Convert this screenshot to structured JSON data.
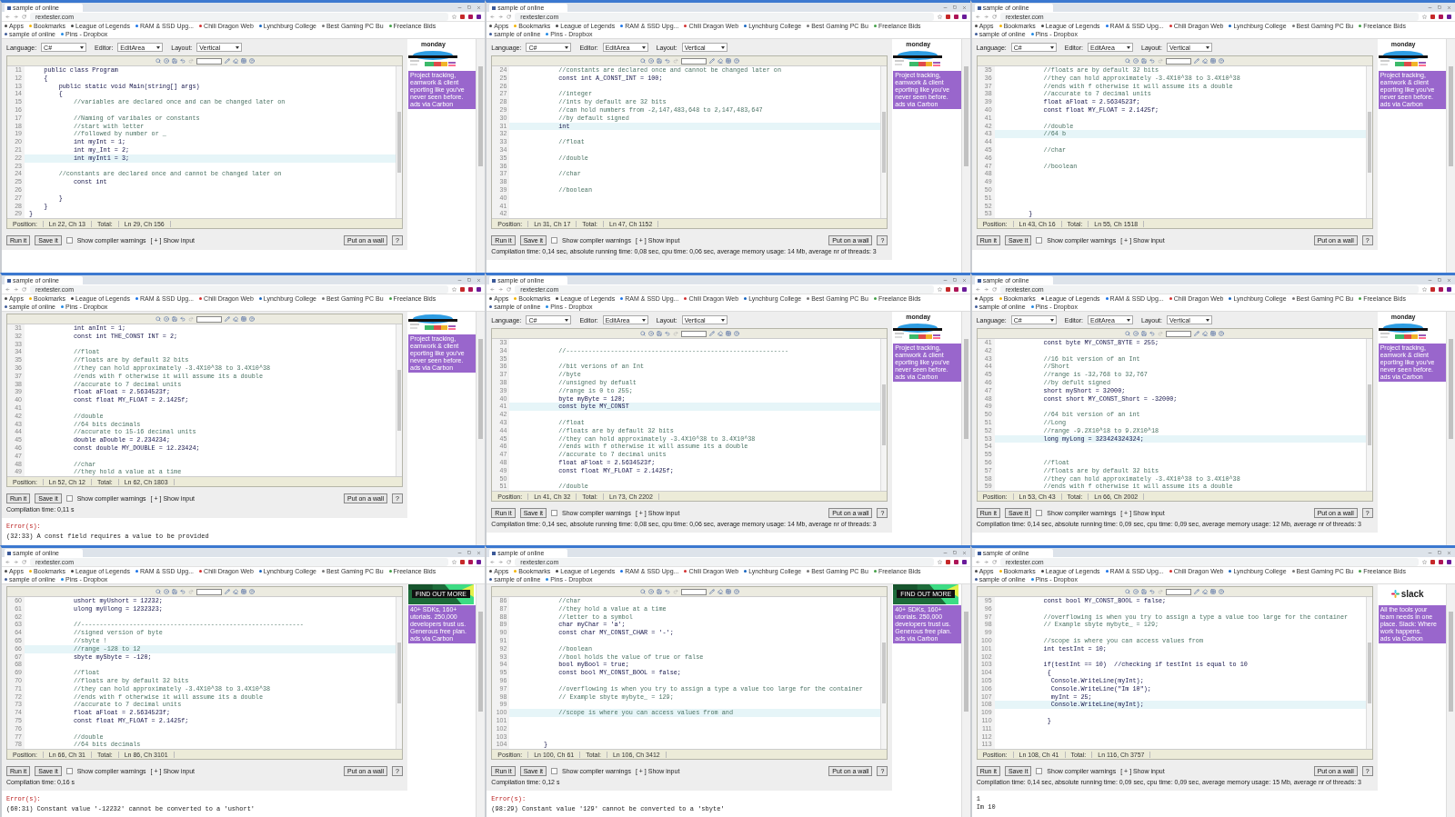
{
  "frames": [
    {
      "browser": {
        "tab": "sample of online",
        "address": "rextester.com",
        "bookmarks": [
          "Apps",
          "Bookmarks",
          "League of Legends",
          "RAM & SSD Upg...",
          "Chili Dragon Web",
          "Lynchburg College",
          "Best Gaming PC Bu",
          "Freelance Bids",
          "sample of online",
          "Pins - Dropbox"
        ]
      },
      "settings": {
        "language_label": "Language:",
        "language": "C#",
        "editor_label": "Editor:",
        "editor": "EditArea",
        "layout_label": "Layout:",
        "layout": "Vertical"
      },
      "ad": {
        "kind": "monday",
        "logo": "monday",
        "text": "Project tracking,\neamwork & client\neporting like you've\nnever seen before.\nads via Carbon"
      },
      "code": [
        {
          "n": "11",
          "kind": "code",
          "text": "    public class Program",
          "current": false
        },
        {
          "n": "12",
          "kind": "code",
          "text": "    {",
          "current": false
        },
        {
          "n": "13",
          "kind": "code",
          "text": "        public static void Main(string[] args)",
          "current": false
        },
        {
          "n": "14",
          "kind": "code",
          "text": "        {",
          "current": false
        },
        {
          "n": "15",
          "kind": "comment",
          "text": "            //variables are declared once and can be changed later on",
          "current": false
        },
        {
          "n": "16",
          "current": false
        },
        {
          "n": "17",
          "kind": "comment",
          "text": "            //Naming of varibales or constants",
          "current": false
        },
        {
          "n": "18",
          "kind": "comment",
          "text": "            //start with letter",
          "current": false
        },
        {
          "n": "19",
          "kind": "comment",
          "text": "            //followed by number or _",
          "current": false
        },
        {
          "n": "20",
          "kind": "code",
          "text": "            int myInt = 1;",
          "current": false
        },
        {
          "n": "21",
          "kind": "code",
          "text": "            int my_Int = 2;",
          "current": false
        },
        {
          "n": "22",
          "kind": "code",
          "text": "            int myInt1 = 3;",
          "current": true
        },
        {
          "n": "23",
          "current": false
        },
        {
          "n": "24",
          "kind": "comment",
          "text": "        //constants are declared once and cannot be changed later on",
          "current": false
        },
        {
          "n": "25",
          "kind": "code",
          "text": "            const int",
          "current": false
        },
        {
          "n": "26",
          "current": false
        },
        {
          "n": "27",
          "kind": "code",
          "text": "        }",
          "current": false
        },
        {
          "n": "28",
          "kind": "code",
          "text": "    }",
          "current": false
        },
        {
          "n": "29",
          "kind": "code",
          "text": "}",
          "current": false
        }
      ],
      "status": {
        "position_label": "Position:",
        "position": "Ln 22, Ch 13",
        "total_label": "Total:",
        "total": "Ln 29, Ch 156"
      },
      "controls": {
        "run": "Run it",
        "save": "Save it",
        "warnings": {
          "label": "Show compiler warnings",
          "checked": false
        },
        "show_input": "[ + ] Show input",
        "wall": "Put on a wall",
        "help": "?"
      }
    },
    {
      "browser": {
        "tab": "sample of online",
        "address": "rextester.com",
        "bookmarks": [
          "Apps",
          "Bookmarks",
          "League of Legends",
          "RAM & SSD Upg...",
          "Chili Dragon Web",
          "Lynchburg College",
          "Best Gaming PC Bu",
          "Freelance Bids",
          "sample of online",
          "Pins - Dropbox"
        ]
      },
      "settings": {
        "language_label": "Language:",
        "language": "C#",
        "editor_label": "Editor:",
        "editor": "EditArea",
        "layout_label": "Layout:",
        "layout": "Vertical"
      },
      "ad": {
        "kind": "monday",
        "logo": "monday",
        "text": "Project tracking,\neamwork & client\neporting like you've\nnever seen before.\nads via Carbon"
      },
      "code": [
        {
          "n": "24",
          "kind": "comment",
          "text": "            //constants are declared once and cannot be changed later on",
          "current": false
        },
        {
          "n": "25",
          "kind": "code",
          "text": "            const int A_CONST_INT = 100;",
          "current": false
        },
        {
          "n": "26",
          "current": false
        },
        {
          "n": "27",
          "kind": "comment",
          "text": "            //integer",
          "current": false
        },
        {
          "n": "28",
          "kind": "comment",
          "text": "            //ints by default are 32 bits",
          "current": false
        },
        {
          "n": "29",
          "kind": "comment",
          "text": "            //can hold numbers from -2,147,483,648 to 2,147,483,647",
          "current": false
        },
        {
          "n": "30",
          "kind": "comment",
          "text": "            //by default signed",
          "current": false
        },
        {
          "n": "31",
          "kind": "code",
          "text": "            int",
          "current": true
        },
        {
          "n": "32",
          "current": false
        },
        {
          "n": "33",
          "kind": "comment",
          "text": "            //float",
          "current": false
        },
        {
          "n": "34",
          "current": false
        },
        {
          "n": "35",
          "kind": "comment",
          "text": "            //double",
          "current": false
        },
        {
          "n": "36",
          "current": false
        },
        {
          "n": "37",
          "kind": "comment",
          "text": "            //char",
          "current": false
        },
        {
          "n": "38",
          "current": false
        },
        {
          "n": "39",
          "kind": "comment",
          "text": "            //boolean",
          "current": false
        },
        {
          "n": "40",
          "current": false
        },
        {
          "n": "41",
          "current": false
        },
        {
          "n": "42",
          "current": false
        }
      ],
      "status": {
        "position_label": "Position:",
        "position": "Ln 31, Ch 17",
        "total_label": "Total:",
        "total": "Ln 47, Ch 1152"
      },
      "controls": {
        "run": "Run it",
        "save": "Save it",
        "warnings": {
          "label": "Show compiler warnings",
          "checked": false
        },
        "show_input": "[ + ] Show input",
        "wall": "Put on a wall",
        "help": "?"
      },
      "compile": "Compilation time: 0,14 sec, absolute running time: 0,08 sec, cpu time: 0,06 sec, average memory usage: 14 Mb, average nr of threads: 3"
    },
    {
      "browser": {
        "tab": "sample of online",
        "address": "rextester.com",
        "bookmarks": [
          "Apps",
          "Bookmarks",
          "League of Legends",
          "RAM & SSD Upg...",
          "Chili Dragon Web",
          "Lynchburg College",
          "Best Gaming PC Bu",
          "Freelance Bids",
          "sample of online",
          "Pins - Dropbox"
        ]
      },
      "settings": {
        "language_label": "Language:",
        "language": "C#",
        "editor_label": "Editor:",
        "editor": "EditArea",
        "layout_label": "Layout:",
        "layout": "Vertical"
      },
      "ad": {
        "kind": "monday",
        "logo": "monday",
        "text": "Project tracking,\neamwork & client\neporting like you've\nnever seen before.\nads via Carbon"
      },
      "code": [
        {
          "n": "35",
          "kind": "comment",
          "text": "            //floats are by default 32 bits",
          "current": false
        },
        {
          "n": "36",
          "kind": "comment",
          "text": "            //they can hold approximately -3.4X10^38 to 3.4X10^38",
          "current": false
        },
        {
          "n": "37",
          "kind": "comment",
          "text": "            //ends with f otherwise it will assume its a double",
          "current": false
        },
        {
          "n": "38",
          "kind": "comment",
          "text": "            //accurate to 7 decimal units",
          "current": false
        },
        {
          "n": "39",
          "kind": "code",
          "text": "            float aFloat = 2.5634523f;",
          "current": false
        },
        {
          "n": "40",
          "kind": "code",
          "text": "            const float MY_FLOAT = 2.1425f;",
          "current": false
        },
        {
          "n": "41",
          "current": false
        },
        {
          "n": "42",
          "kind": "comment",
          "text": "            //double",
          "current": false
        },
        {
          "n": "43",
          "kind": "comment",
          "text": "            //64 b",
          "current": true
        },
        {
          "n": "44",
          "current": false
        },
        {
          "n": "45",
          "kind": "comment",
          "text": "            //char",
          "current": false
        },
        {
          "n": "46",
          "current": false
        },
        {
          "n": "47",
          "kind": "comment",
          "text": "            //boolean",
          "current": false
        },
        {
          "n": "48",
          "current": false
        },
        {
          "n": "49",
          "current": false
        },
        {
          "n": "50",
          "current": false
        },
        {
          "n": "51",
          "current": false
        },
        {
          "n": "52",
          "current": false
        },
        {
          "n": "53",
          "kind": "code",
          "text": "        }",
          "current": false
        }
      ],
      "status": {
        "position_label": "Position:",
        "position": "Ln 43, Ch 16",
        "total_label": "Total:",
        "total": "Ln 55, Ch 1518"
      },
      "controls": {
        "run": "Run it",
        "save": "Save it",
        "warnings": {
          "label": "Show compiler warnings",
          "checked": false
        },
        "show_input": "[ + ] Show input",
        "wall": "Put on a wall",
        "help": "?"
      }
    },
    {
      "browser": {
        "tab": "sample of online",
        "address": "rextester.com",
        "bookmarks": [
          "Apps",
          "Bookmarks",
          "League of Legends",
          "RAM & SSD Upg...",
          "Chili Dragon Web",
          "Lynchburg College",
          "Best Gaming PC Bu",
          "Freelance Bids",
          "sample of online",
          "Pins - Dropbox"
        ]
      },
      "ad": {
        "kind": "monday",
        "text": "Project tracking,\neamwork & client\neporting like you've\nnever seen before.\nads via Carbon"
      },
      "code": [
        {
          "n": "31",
          "kind": "code",
          "text": "            int anInt = 1;",
          "current": false
        },
        {
          "n": "32",
          "kind": "code",
          "text": "            const int THE_CONST INT = 2;",
          "current": false
        },
        {
          "n": "33",
          "current": false
        },
        {
          "n": "34",
          "kind": "comment",
          "text": "            //float",
          "current": false
        },
        {
          "n": "35",
          "kind": "comment",
          "text": "            //floats are by default 32 bits",
          "current": false
        },
        {
          "n": "36",
          "kind": "comment",
          "text": "            //they can hold approximately -3.4X10^38 to 3.4X10^38",
          "current": false
        },
        {
          "n": "37",
          "kind": "comment",
          "text": "            //ends with f otherwise it will assume its a double",
          "current": false
        },
        {
          "n": "38",
          "kind": "comment",
          "text": "            //accurate to 7 decimal units",
          "current": false
        },
        {
          "n": "39",
          "kind": "code",
          "text": "            float aFloat = 2.5634523f;",
          "current": false
        },
        {
          "n": "40",
          "kind": "code",
          "text": "            const float MY_FLOAT = 2.1425f;",
          "current": false
        },
        {
          "n": "41",
          "current": false
        },
        {
          "n": "42",
          "kind": "comment",
          "text": "            //double",
          "current": false
        },
        {
          "n": "43",
          "kind": "comment",
          "text": "            //64 bits decimals",
          "current": false
        },
        {
          "n": "44",
          "kind": "comment",
          "text": "            //accurate to 15-16 decimal units",
          "current": false
        },
        {
          "n": "45",
          "kind": "code",
          "text": "            double aDouble = 2.234234;",
          "current": false
        },
        {
          "n": "46",
          "kind": "code",
          "text": "            const double MY_DOUBLE = 12.23424;",
          "current": false
        },
        {
          "n": "47",
          "current": false
        },
        {
          "n": "48",
          "kind": "comment",
          "text": "            //char",
          "current": false
        },
        {
          "n": "49",
          "kind": "comment",
          "text": "            //they hold a value at a time",
          "current": false
        }
      ],
      "status": {
        "position_label": "Position:",
        "position": "Ln 52, Ch 12",
        "total_label": "Total:",
        "total": "Ln 62, Ch 1803"
      },
      "controls": {
        "run": "Run it",
        "save": "Save it",
        "warnings": {
          "label": "Show compiler warnings",
          "checked": false
        },
        "show_input": "[ + ] Show input",
        "wall": "Put on a wall",
        "help": "?"
      },
      "compile": "Compilation time: 0,11 s",
      "errors": {
        "title": "Error(s):",
        "message": "(32:33) A const field requires a value to be provided"
      }
    },
    {
      "browser": {
        "tab": "sample of online",
        "address": "rextester.com",
        "bookmarks": [
          "Apps",
          "Bookmarks",
          "League of Legends",
          "RAM & SSD Upg...",
          "Chili Dragon Web",
          "Lynchburg College",
          "Best Gaming PC Bu",
          "Freelance Bids",
          "sample of online",
          "Pins - Dropbox"
        ]
      },
      "settings": {
        "language_label": "Language:",
        "language": "C#",
        "editor_label": "Editor:",
        "editor": "EditArea",
        "layout_label": "Layout:",
        "layout": "Vertical"
      },
      "ad": {
        "kind": "monday",
        "logo": "monday",
        "text": "Project tracking,\neamwork & client\neporting like you've\nnever seen before.\nads via Carbon"
      },
      "code": [
        {
          "n": "33",
          "current": false
        },
        {
          "n": "34",
          "kind": "comment",
          "text": "            //------------------------------------------------------------",
          "current": false
        },
        {
          "n": "35",
          "current": false
        },
        {
          "n": "36",
          "kind": "comment",
          "text": "            //bit verions of an Int",
          "current": false
        },
        {
          "n": "37",
          "kind": "comment",
          "text": "            //byte",
          "current": false
        },
        {
          "n": "38",
          "kind": "comment",
          "text": "            //unsigned by defualt",
          "current": false
        },
        {
          "n": "39",
          "kind": "comment",
          "text": "            //range is 0 to 255;",
          "current": false
        },
        {
          "n": "40",
          "kind": "code",
          "text": "            byte myByte = 120;",
          "current": false
        },
        {
          "n": "41",
          "kind": "code",
          "text": "            const byte MY_CONST",
          "current": true
        },
        {
          "n": "42",
          "current": false
        },
        {
          "n": "43",
          "kind": "comment",
          "text": "            //float",
          "current": false
        },
        {
          "n": "44",
          "kind": "comment",
          "text": "            //floats are by default 32 bits",
          "current": false
        },
        {
          "n": "45",
          "kind": "comment",
          "text": "            //they can hold approximately -3.4X10^38 to 3.4X10^38",
          "current": false
        },
        {
          "n": "46",
          "kind": "comment",
          "text": "            //ends with f otherwise it will assume its a double",
          "current": false
        },
        {
          "n": "47",
          "kind": "comment",
          "text": "            //accurate to 7 decimal units",
          "current": false
        },
        {
          "n": "48",
          "kind": "code",
          "text": "            float aFloat = 2.5634523f;",
          "current": false
        },
        {
          "n": "49",
          "kind": "code",
          "text": "            const float MY_FLOAT = 2.1425f;",
          "current": false
        },
        {
          "n": "50",
          "current": false
        },
        {
          "n": "51",
          "kind": "comment",
          "text": "            //double",
          "current": false
        }
      ],
      "status": {
        "position_label": "Position:",
        "position": "Ln 41, Ch 32",
        "total_label": "Total:",
        "total": "Ln 73, Ch 2202"
      },
      "controls": {
        "run": "Run it",
        "save": "Save it",
        "warnings": {
          "label": "Show compiler warnings",
          "checked": false
        },
        "show_input": "[ + ] Show input",
        "wall": "Put on a wall",
        "help": "?"
      },
      "compile": "Compilation time: 0,14 sec, absolute running time: 0,08 sec, cpu time: 0,06 sec, average memory usage: 14 Mb, average nr of threads: 3"
    },
    {
      "browser": {
        "tab": "sample of online",
        "address": "rextester.com",
        "bookmarks": [
          "Apps",
          "Bookmarks",
          "League of Legends",
          "RAM & SSD Upg...",
          "Chili Dragon Web",
          "Lynchburg College",
          "Best Gaming PC Bu",
          "Freelance Bids",
          "sample of online",
          "Pins - Dropbox"
        ]
      },
      "settings": {
        "language_label": "Language:",
        "language": "C#",
        "editor_label": "Editor:",
        "editor": "EditArea",
        "layout_label": "Layout:",
        "layout": "Vertical"
      },
      "ad": {
        "kind": "monday",
        "logo": "monday",
        "text": "Project tracking,\neamwork & client\neporting like you've\nnever seen before.\nads via Carbon"
      },
      "code": [
        {
          "n": "41",
          "kind": "code",
          "text": "            const byte MY_CONST_BYTE = 255;",
          "current": false
        },
        {
          "n": "42",
          "current": false
        },
        {
          "n": "43",
          "kind": "comment",
          "text": "            //16 bit version of an Int",
          "current": false
        },
        {
          "n": "44",
          "kind": "comment",
          "text": "            //Short",
          "current": false
        },
        {
          "n": "45",
          "kind": "comment",
          "text": "            //range is -32,768 to 32,767",
          "current": false
        },
        {
          "n": "46",
          "kind": "comment",
          "text": "            //by defult signed",
          "current": false
        },
        {
          "n": "47",
          "kind": "code",
          "text": "            short myShort = 32000;",
          "current": false
        },
        {
          "n": "48",
          "kind": "code",
          "text": "            const short MY_CONST_Short = -32000;",
          "current": false
        },
        {
          "n": "49",
          "current": false
        },
        {
          "n": "50",
          "kind": "comment",
          "text": "            //64 bit version of an int",
          "current": false
        },
        {
          "n": "51",
          "kind": "comment",
          "text": "            //Long",
          "current": false
        },
        {
          "n": "52",
          "kind": "comment",
          "text": "            //range -9.2X10^18 to 9.2X10^18",
          "current": false
        },
        {
          "n": "53",
          "kind": "code",
          "text": "            long myLong = 323424324324;",
          "current": true
        },
        {
          "n": "54",
          "current": false
        },
        {
          "n": "55",
          "current": false
        },
        {
          "n": "56",
          "kind": "comment",
          "text": "            //float",
          "current": false
        },
        {
          "n": "57",
          "kind": "comment",
          "text": "            //floats are by default 32 bits",
          "current": false
        },
        {
          "n": "58",
          "kind": "comment",
          "text": "            //they can hold approximately -3.4X10^38 to 3.4X10^38",
          "current": false
        },
        {
          "n": "59",
          "kind": "comment",
          "text": "            //ends with f otherwise it will assume its a double",
          "current": false
        }
      ],
      "status": {
        "position_label": "Position:",
        "position": "Ln 53, Ch 43",
        "total_label": "Total:",
        "total": "Ln 66, Ch 2002"
      },
      "controls": {
        "run": "Run it",
        "save": "Save it",
        "warnings": {
          "label": "Show compiler warnings",
          "checked": false
        },
        "show_input": "[ + ] Show input",
        "wall": "Put on a wall",
        "help": "?"
      },
      "compile": "Compilation time: 0,14 sec, absolute running time: 0,09 sec, cpu time: 0,09 sec, average memory usage: 12 Mb, average nr of threads: 3"
    },
    {
      "browser": {
        "tab": "sample of online",
        "address": "rextester.com",
        "bookmarks": [
          "Apps",
          "Bookmarks",
          "League of Legends",
          "RAM & SSD Upg...",
          "Chili Dragon Web",
          "Lynchburg College",
          "Best Gaming PC Bu",
          "Freelance Bids",
          "sample of online",
          "Pins - Dropbox"
        ]
      },
      "ad": {
        "kind": "carbon",
        "button": "FIND OUT MORE",
        "text": "40+ SDKs, 160+\nutorials. 250,000\ndevelopers trust us.\nGenerous free plan.\nads via Carbon"
      },
      "code": [
        {
          "n": "60",
          "kind": "code",
          "text": "            ushort myUshort = 12232;",
          "current": false
        },
        {
          "n": "61",
          "kind": "code",
          "text": "            ulong myUlong = 1232323;",
          "current": false
        },
        {
          "n": "62",
          "current": false
        },
        {
          "n": "63",
          "kind": "comment",
          "text": "            //------------------------------------------------------------",
          "current": false
        },
        {
          "n": "64",
          "kind": "comment",
          "text": "            //signed version of byte",
          "current": false
        },
        {
          "n": "65",
          "kind": "comment",
          "text": "            //sbyte !",
          "current": false
        },
        {
          "n": "66",
          "kind": "comment",
          "text": "            //range -128 to 12",
          "current": true
        },
        {
          "n": "67",
          "kind": "code",
          "text": "            sbyte mySbyte = -120;",
          "current": false
        },
        {
          "n": "68",
          "current": false
        },
        {
          "n": "69",
          "kind": "comment",
          "text": "            //float",
          "current": false
        },
        {
          "n": "70",
          "kind": "comment",
          "text": "            //floats are by default 32 bits",
          "current": false
        },
        {
          "n": "71",
          "kind": "comment",
          "text": "            //they can hold approximately -3.4X10^38 to 3.4X10^38",
          "current": false
        },
        {
          "n": "72",
          "kind": "comment",
          "text": "            //ends with f otherwise it will assume its a double",
          "current": false
        },
        {
          "n": "73",
          "kind": "comment",
          "text": "            //accurate to 7 decimal units",
          "current": false
        },
        {
          "n": "74",
          "kind": "code",
          "text": "            float aFloat = 2.5634523f;",
          "current": false
        },
        {
          "n": "75",
          "kind": "code",
          "text": "            const float MY_FLOAT = 2.1425f;",
          "current": false
        },
        {
          "n": "76",
          "current": false
        },
        {
          "n": "77",
          "kind": "comment",
          "text": "            //double",
          "current": false
        },
        {
          "n": "78",
          "kind": "comment",
          "text": "            //64 bits decimals",
          "current": false
        }
      ],
      "status": {
        "position_label": "Position:",
        "position": "Ln 66, Ch 31",
        "total_label": "Total:",
        "total": "Ln 86, Ch 3101"
      },
      "controls": {
        "run": "Run it",
        "save": "Save it",
        "warnings": {
          "label": "Show compiler warnings",
          "checked": false
        },
        "show_input": "[ + ] Show input",
        "wall": "Put on a wall",
        "help": "?"
      },
      "compile": "Compilation time: 0,16 s",
      "errors": {
        "title": "Error(s):",
        "message": "(60:31) Constant value '-12232' cannot be converted to a 'ushort'"
      }
    },
    {
      "browser": {
        "tab": "sample of online",
        "address": "rextester.com",
        "bookmarks": [
          "Apps",
          "Bookmarks",
          "League of Legends",
          "RAM & SSD Upg...",
          "Chili Dragon Web",
          "Lynchburg College",
          "Best Gaming PC Bu",
          "Freelance Bids",
          "sample of online",
          "Pins - Dropbox"
        ]
      },
      "ad": {
        "kind": "carbon",
        "button": "FIND OUT MORE",
        "text": "40+ SDKs, 160+\nutorials. 250,000\ndevelopers trust us.\nGenerous free plan.\nads via Carbon"
      },
      "code": [
        {
          "n": "86",
          "kind": "comment",
          "text": "            //char",
          "current": false
        },
        {
          "n": "87",
          "kind": "comment",
          "text": "            //they hold a value at a time",
          "current": false
        },
        {
          "n": "88",
          "kind": "comment",
          "text": "            //letter to a symbol",
          "current": false
        },
        {
          "n": "89",
          "kind": "code",
          "text": "            char myChar = 'a';",
          "current": false
        },
        {
          "n": "90",
          "kind": "code",
          "text": "            const char MY_CONST_CHAR = '-';",
          "current": false
        },
        {
          "n": "91",
          "current": false
        },
        {
          "n": "92",
          "kind": "comment",
          "text": "            //boolean",
          "current": false
        },
        {
          "n": "93",
          "kind": "comment",
          "text": "            //bool holds the value of true or false",
          "current": false
        },
        {
          "n": "94",
          "kind": "code",
          "text": "            bool myBool = true;",
          "current": false
        },
        {
          "n": "95",
          "kind": "code",
          "text": "            const bool MY_CONST_BOOL = false;",
          "current": false
        },
        {
          "n": "96",
          "current": false
        },
        {
          "n": "97",
          "kind": "comment",
          "text": "            //overflowing is when you try to assign a type a value too large for the container",
          "current": false
        },
        {
          "n": "98",
          "kind": "comment",
          "text": "            // Example sbyte mybyte_ = 129;",
          "current": false
        },
        {
          "n": "99",
          "current": false
        },
        {
          "n": "100",
          "kind": "comment",
          "text": "            //scope is where you can access values from and",
          "current": true
        },
        {
          "n": "101",
          "current": false
        },
        {
          "n": "102",
          "current": false
        },
        {
          "n": "103",
          "current": false
        },
        {
          "n": "104",
          "kind": "code",
          "text": "        }",
          "current": false
        }
      ],
      "status": {
        "position_label": "Position:",
        "position": "Ln 100, Ch 61",
        "total_label": "Total:",
        "total": "Ln 106, Ch 3412"
      },
      "controls": {
        "run": "Run it",
        "save": "Save it",
        "warnings": {
          "label": "Show compiler warnings",
          "checked": false
        },
        "show_input": "[ + ] Show input",
        "wall": "Put on a wall",
        "help": "?"
      },
      "compile": "Compilation time: 0,12 s",
      "errors": {
        "title": "Error(s):",
        "message": "(98:29) Constant value '129' cannot be converted to a 'sbyte'"
      }
    },
    {
      "browser": {
        "tab": "sample of online",
        "address": "rextester.com",
        "bookmarks": [
          "Apps",
          "Bookmarks",
          "League of Legends",
          "RAM & SSD Upg...",
          "Chili Dragon Web",
          "Lynchburg College",
          "Best Gaming PC Bu",
          "Freelance Bids",
          "sample of online",
          "Pins - Dropbox"
        ]
      },
      "ad": {
        "kind": "slack",
        "logo": "slack",
        "text": "All the tools your\nteam needs in one\nplace. Slack: Where\nwork happens.\nads via Carbon"
      },
      "code": [
        {
          "n": "95",
          "kind": "code",
          "text": "            const bool MY_CONST_BOOL = false;",
          "current": false
        },
        {
          "n": "96",
          "current": false
        },
        {
          "n": "97",
          "kind": "comment",
          "text": "            //overflowing is when you try to assign a type a value too large for the container",
          "current": false
        },
        {
          "n": "98",
          "kind": "comment",
          "text": "            // Example sbyte mybyte_ = 129;",
          "current": false
        },
        {
          "n": "99",
          "current": false
        },
        {
          "n": "100",
          "kind": "comment",
          "text": "            //scope is where you can access values from",
          "current": false
        },
        {
          "n": "101",
          "kind": "code",
          "text": "            int testInt = 10;",
          "current": false
        },
        {
          "n": "102",
          "current": false
        },
        {
          "n": "103",
          "kind": "code",
          "text": "            if(testInt == 10)  //checking if testInt is equal to 10",
          "current": false
        },
        {
          "n": "104",
          "kind": "code",
          "text": "             {",
          "current": false
        },
        {
          "n": "105",
          "kind": "code",
          "text": "              Console.WriteLine(myInt);",
          "current": false
        },
        {
          "n": "106",
          "kind": "code",
          "text": "              Console.WriteLine(\"Im 10\");",
          "current": false
        },
        {
          "n": "107",
          "kind": "code",
          "text": "              myInt = 25;",
          "current": false
        },
        {
          "n": "108",
          "kind": "code",
          "text": "              Console.WriteLine(myInt);",
          "current": true
        },
        {
          "n": "109",
          "current": false
        },
        {
          "n": "110",
          "kind": "code",
          "text": "             }",
          "current": false
        },
        {
          "n": "111",
          "current": false
        },
        {
          "n": "112",
          "current": false
        },
        {
          "n": "113",
          "current": false
        }
      ],
      "status": {
        "position_label": "Position:",
        "position": "Ln 108, Ch 41",
        "total_label": "Total:",
        "total": "Ln 116, Ch 3757"
      },
      "controls": {
        "run": "Run it",
        "save": "Save it",
        "warnings": {
          "label": "Show compiler warnings",
          "checked": false
        },
        "show_input": "[ + ] Show input",
        "wall": "Put on a wall",
        "help": "?"
      },
      "compile": "Compilation time: 0,14 sec, absolute running time: 0,09 sec, cpu time: 0,09 sec, average memory usage: 15 Mb, average nr of threads: 3",
      "output": [
        "1",
        "Im 10"
      ]
    }
  ]
}
